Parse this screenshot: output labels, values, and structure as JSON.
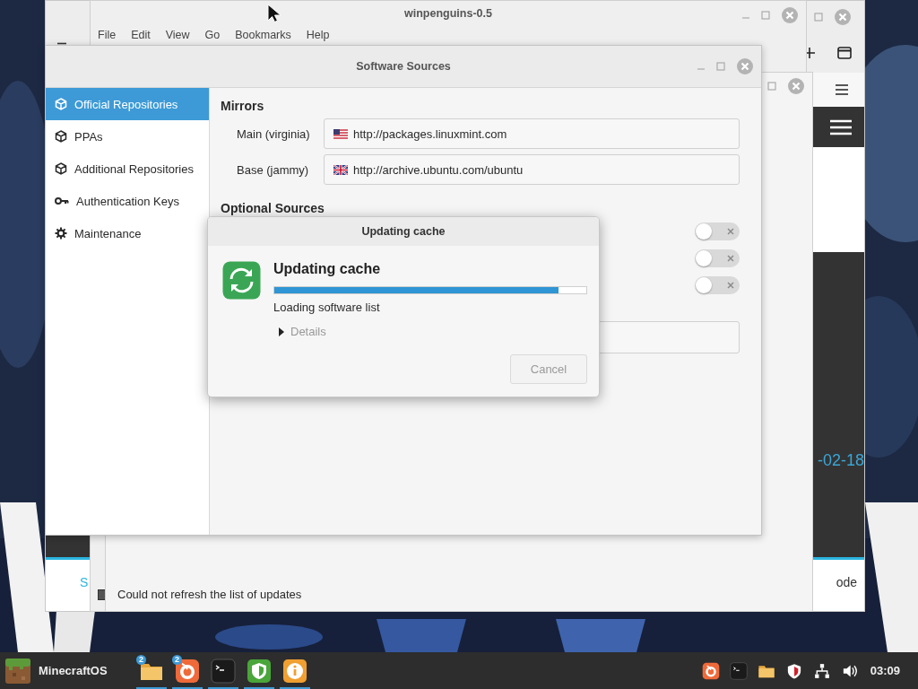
{
  "browser_window": {
    "page": {
      "date_text": "-02-18",
      "footer_left": "S",
      "footer_right": "ode"
    }
  },
  "file_manager": {
    "title": "winpenguins-0.5",
    "menu": [
      "File",
      "Edit",
      "View",
      "Go",
      "Bookmarks",
      "Help"
    ]
  },
  "update_manager": {
    "status": "Could not refresh the list of updates"
  },
  "software_sources": {
    "title": "Software Sources",
    "sidebar": [
      {
        "label": "Official Repositories",
        "kind": "package",
        "selected": true
      },
      {
        "label": "PPAs",
        "kind": "package",
        "selected": false
      },
      {
        "label": "Additional Repositories",
        "kind": "package",
        "selected": false
      },
      {
        "label": "Authentication Keys",
        "kind": "key",
        "selected": false
      },
      {
        "label": "Maintenance",
        "kind": "gear",
        "selected": false
      }
    ],
    "mirrors": {
      "heading": "Mirrors",
      "rows": [
        {
          "label": "Main (virginia)",
          "kind": "us",
          "value": "http://packages.linuxmint.com"
        },
        {
          "label": "Base (jammy)",
          "kind": "uk",
          "value": "http://archive.ubuntu.com/ubuntu"
        }
      ]
    },
    "optional": {
      "heading": "Optional Sources",
      "toggles": [
        {
          "on": false
        },
        {
          "on": false
        },
        {
          "on": false
        }
      ]
    }
  },
  "dialog": {
    "title": "Updating cache",
    "heading": "Updating cache",
    "level": 0.91,
    "status": "Loading software list",
    "details": {
      "label": "Details",
      "expanded": false
    },
    "cancel": {
      "label": "Cancel",
      "disabled": true
    }
  },
  "taskbar": {
    "menu_label": "MinecraftOS",
    "apps": [
      {
        "kind": "folder",
        "badge": "2",
        "running": true
      },
      {
        "kind": "browser",
        "badge": "2",
        "running": true
      },
      {
        "kind": "terminal",
        "running": true
      },
      {
        "kind": "shield",
        "running": true
      },
      {
        "kind": "info",
        "running": true
      }
    ],
    "tray": [
      {
        "kind": "browser"
      },
      {
        "kind": "terminal"
      },
      {
        "kind": "folder"
      },
      {
        "kind": "shield"
      },
      {
        "kind": "network"
      },
      {
        "kind": "volume"
      }
    ],
    "clock": "03:09"
  }
}
